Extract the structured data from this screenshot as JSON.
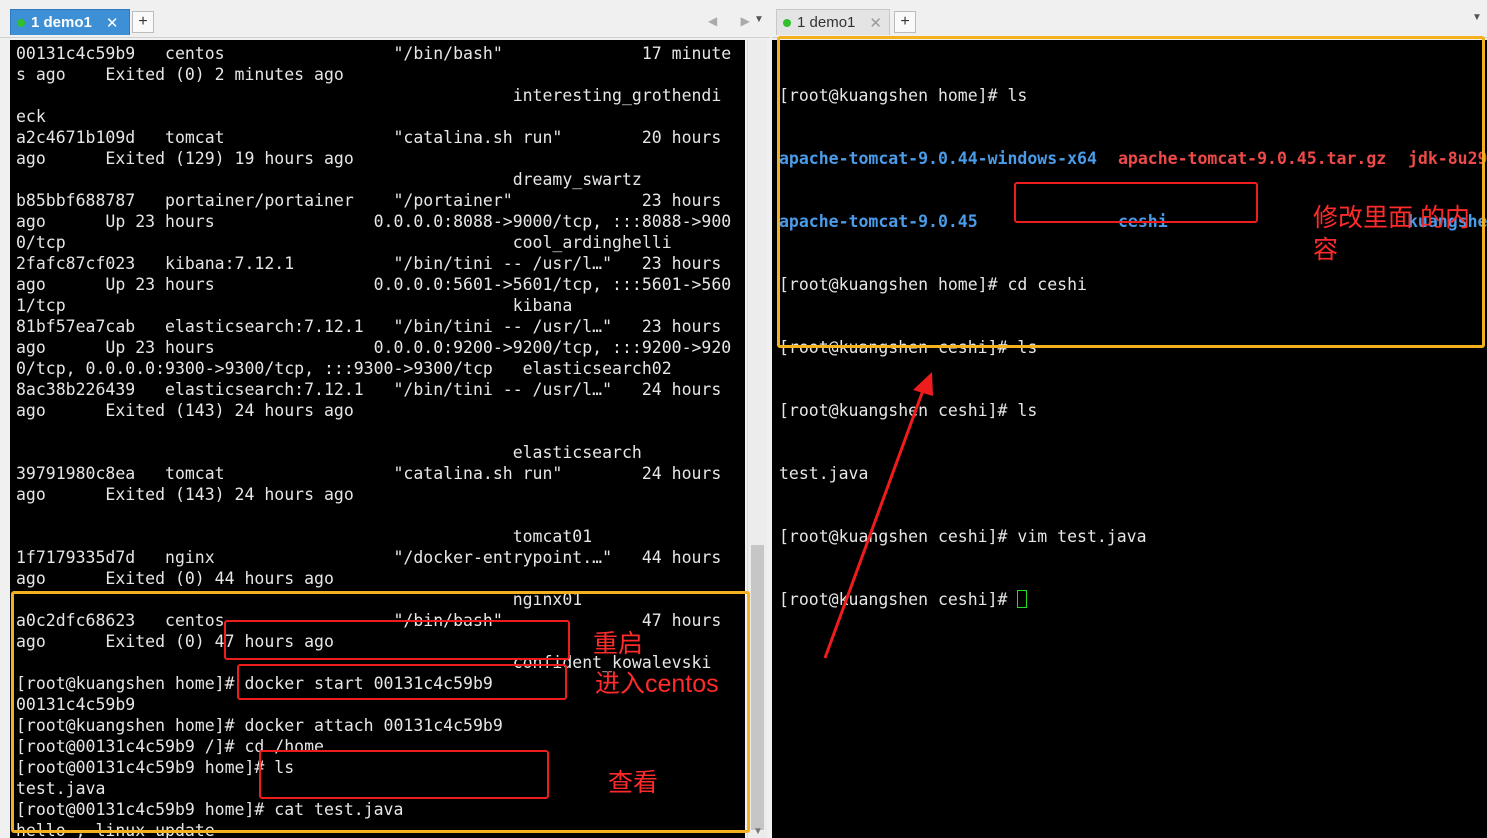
{
  "left_pane": {
    "tab_label": "1 demo1",
    "close_glyph": "✕",
    "new_tab_glyph": "+",
    "nav_glyphs": "◀ ▶",
    "dropdown_glyph": "▼",
    "lines": [
      "00131c4c59b9   centos                 \"/bin/bash\"              17 minute",
      "s ago    Exited (0) 2 minutes ago",
      "                                                  interesting_grothendi",
      "eck",
      "a2c4671b109d   tomcat                 \"catalina.sh run\"        20 hours",
      "ago      Exited (129) 19 hours ago",
      "                                                  dreamy_swartz",
      "b85bbf688787   portainer/portainer    \"/portainer\"             23 hours",
      "ago      Up 23 hours                0.0.0.0:8088->9000/tcp, :::8088->900",
      "0/tcp                                             cool_ardinghelli",
      "2fafc87cf023   kibana:7.12.1          \"/bin/tini -- /usr/l…\"   23 hours",
      "ago      Up 23 hours                0.0.0.0:5601->5601/tcp, :::5601->560",
      "1/tcp                                             kibana",
      "81bf57ea7cab   elasticsearch:7.12.1   \"/bin/tini -- /usr/l…\"   23 hours",
      "ago      Up 23 hours                0.0.0.0:9200->9200/tcp, :::9200->920",
      "0/tcp, 0.0.0.0:9300->9300/tcp, :::9300->9300/tcp   elasticsearch02",
      "8ac38b226439   elasticsearch:7.12.1   \"/bin/tini -- /usr/l…\"   24 hours",
      "ago      Exited (143) 24 hours ago",
      "",
      "                                                  elasticsearch",
      "39791980c8ea   tomcat                 \"catalina.sh run\"        24 hours",
      "ago      Exited (143) 24 hours ago",
      "",
      "                                                  tomcat01",
      "1f7179335d7d   nginx                  \"/docker-entrypoint.…\"   44 hours",
      "ago      Exited (0) 44 hours ago",
      "                                                  nginx01",
      "a0c2dfc68623   centos                 \"/bin/bash\"              47 hours",
      "ago      Exited (0) 47 hours ago",
      "                                                  confident_kowalevski",
      "[root@kuangshen home]# docker start 00131c4c59b9",
      "00131c4c59b9",
      "[root@kuangshen home]# docker attach 00131c4c59b9",
      "[root@00131c4c59b9 /]# cd /home",
      "[root@00131c4c59b9 home]# ls",
      "test.java",
      "[root@00131c4c59b9 home]# cat test.java",
      "hello , linux update"
    ],
    "last_prompt": "[root@00131c4c59b9 home]# "
  },
  "right_pane": {
    "tab_label": "1 demo1",
    "close_glyph": "✕",
    "new_tab_glyph": "+",
    "line1": "[root@kuangshen home]# ls",
    "ls_row1": [
      "apache-tomcat-9.0.44-windows-x64",
      "apache-tomcat-9.0.45.tar.gz",
      "jdk-8u29"
    ],
    "ls_row2": [
      "apache-tomcat-9.0.45",
      "ceshi",
      "kuangshe"
    ],
    "lines_after": [
      "[root@kuangshen home]# cd ceshi",
      "[root@kuangshen ceshi]# ls",
      "[root@kuangshen ceshi]# ls",
      "test.java",
      "[root@kuangshen ceshi]# vim test.java"
    ],
    "last_prompt": "[root@kuangshen ceshi]# "
  },
  "annotations": {
    "restart": "重启",
    "enter_centos": "进入centos",
    "view": "查看",
    "modify_line1": "修改里面 的内",
    "modify_line2": "容"
  },
  "colors": {
    "terminal_bg": "#000000",
    "terminal_text": "#e6e6e6",
    "cursor": "#22dd22",
    "dir_blue": "#4a9be8",
    "archive_red": "#ef4a4a",
    "highlight_yellow": "#f5b020",
    "annotation_red": "#ee1c1c",
    "tab_active": "#3d8fd6"
  },
  "icons": [
    "connection-status-dot",
    "close-icon",
    "new-tab-icon",
    "tab-scroll-arrows-icon",
    "dropdown-icon"
  ]
}
